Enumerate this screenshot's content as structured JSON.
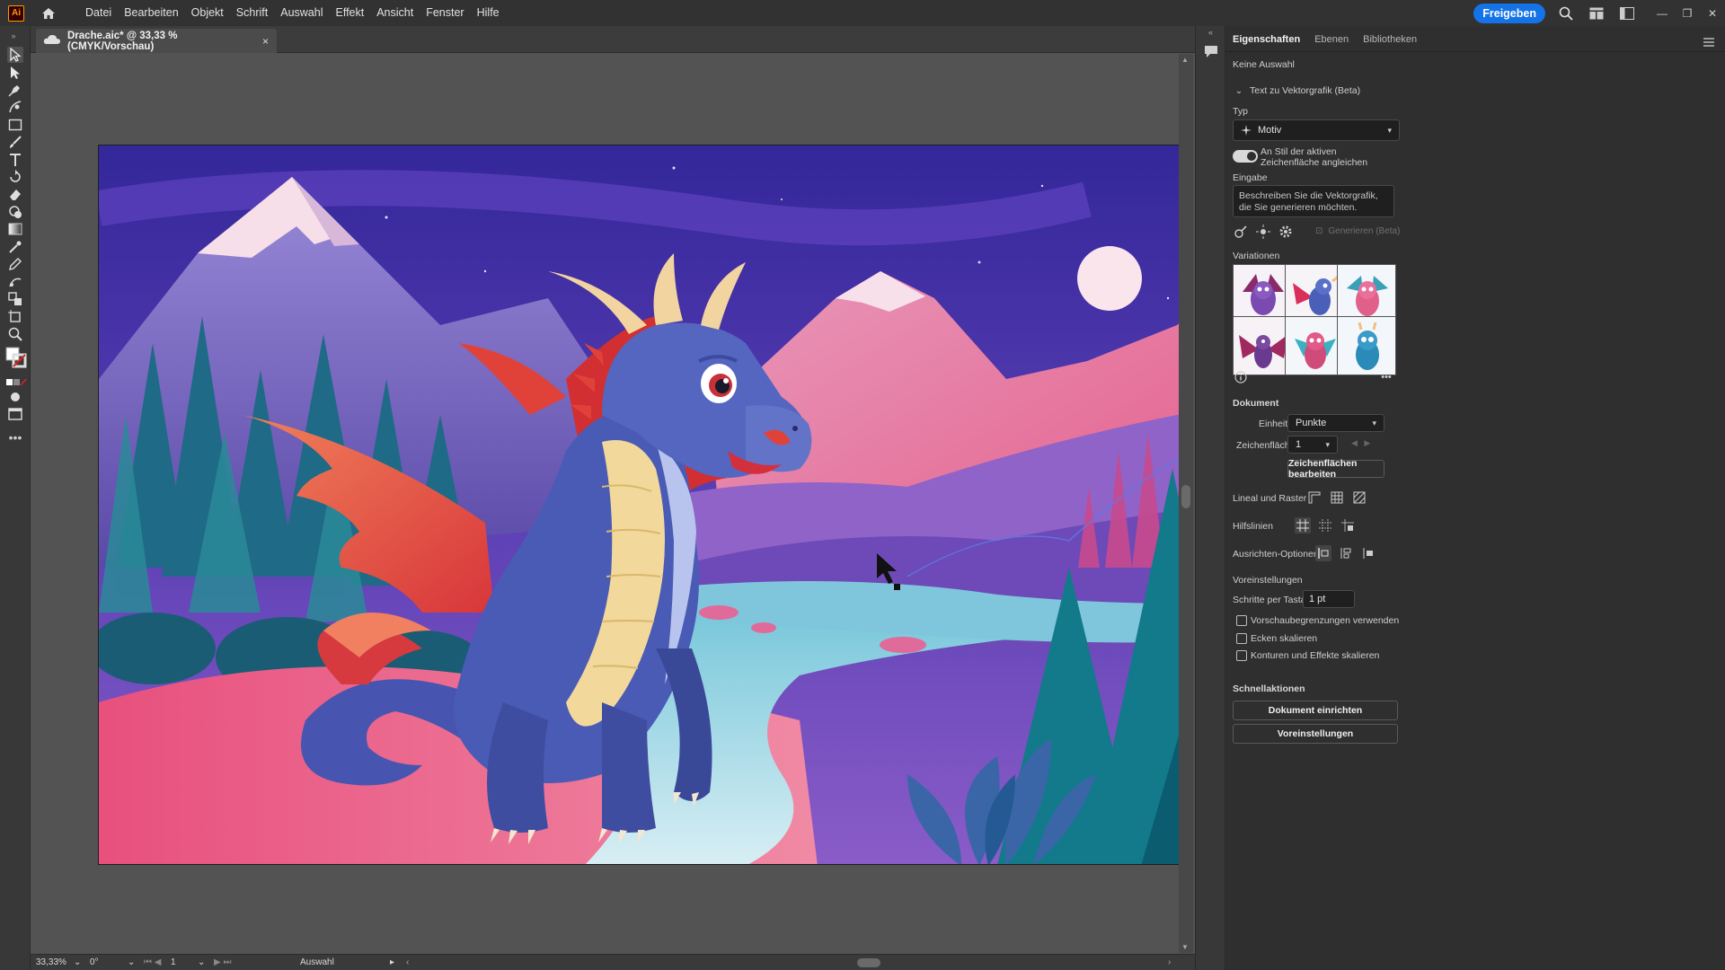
{
  "app": {
    "logo_text": "Ai",
    "menus": [
      "Datei",
      "Bearbeiten",
      "Objekt",
      "Schrift",
      "Auswahl",
      "Effekt",
      "Ansicht",
      "Fenster",
      "Hilfe"
    ],
    "share_label": "Freigeben"
  },
  "document": {
    "tab_title": "Drache.aic* @ 33,33 % (CMYK/Vorschau)",
    "close_glyph": "×"
  },
  "statusbar": {
    "zoom": "33,33%",
    "rotation": "0°",
    "artboard_number": "1",
    "tool_name": "Auswahl"
  },
  "panel": {
    "tabs": [
      "Eigenschaften",
      "Ebenen",
      "Bibliotheken"
    ],
    "no_selection": "Keine Auswahl",
    "section_text_to_vector": "Text zu Vektorgrafik (Beta)",
    "type_label": "Typ",
    "type_value": "Motiv",
    "match_style_label": "An Stil der aktiven Zeichenfläche angleichen",
    "input_label": "Eingabe",
    "input_placeholder": "Beschreiben Sie die Vektorgrafik, die Sie generieren möchten.",
    "generate_label": "Generieren (Beta)",
    "variations_label": "Variationen",
    "document_label": "Dokument",
    "unit_label": "Einheit:",
    "unit_value": "Punkte",
    "artboard_label": "Zeichenfläche:",
    "artboard_value": "1",
    "edit_artboards": "Zeichenflächen bearbeiten",
    "rulers_grids": "Lineal und Raster",
    "guides": "Hilfslinien",
    "align_options": "Ausrichten-Optionen",
    "preferences": "Voreinstellungen",
    "keyboard_increment_label": "Schritte per Tastatur:",
    "keyboard_increment_value": "1 pt",
    "chk_preview_bounds": "Vorschaubegrenzungen verwenden",
    "chk_scale_corners": "Ecken skalieren",
    "chk_scale_strokes": "Konturen und Effekte skalieren",
    "quick_actions": "Schnellaktionen",
    "btn_doc_setup": "Dokument einrichten",
    "btn_preferences": "Voreinstellungen"
  },
  "colors": {
    "accent": "#1473e6",
    "sky_top": "#3b2f9c",
    "sky_bottom": "#7a4fc4",
    "mountain_pink": "#e8628c",
    "dragon_body": "#4b5cb8",
    "dragon_wing": "#e0423a",
    "river": "#9fd4e8",
    "tree_teal": "#0f7f8a"
  },
  "icons": {
    "home": "home-icon",
    "search": "search-icon"
  }
}
